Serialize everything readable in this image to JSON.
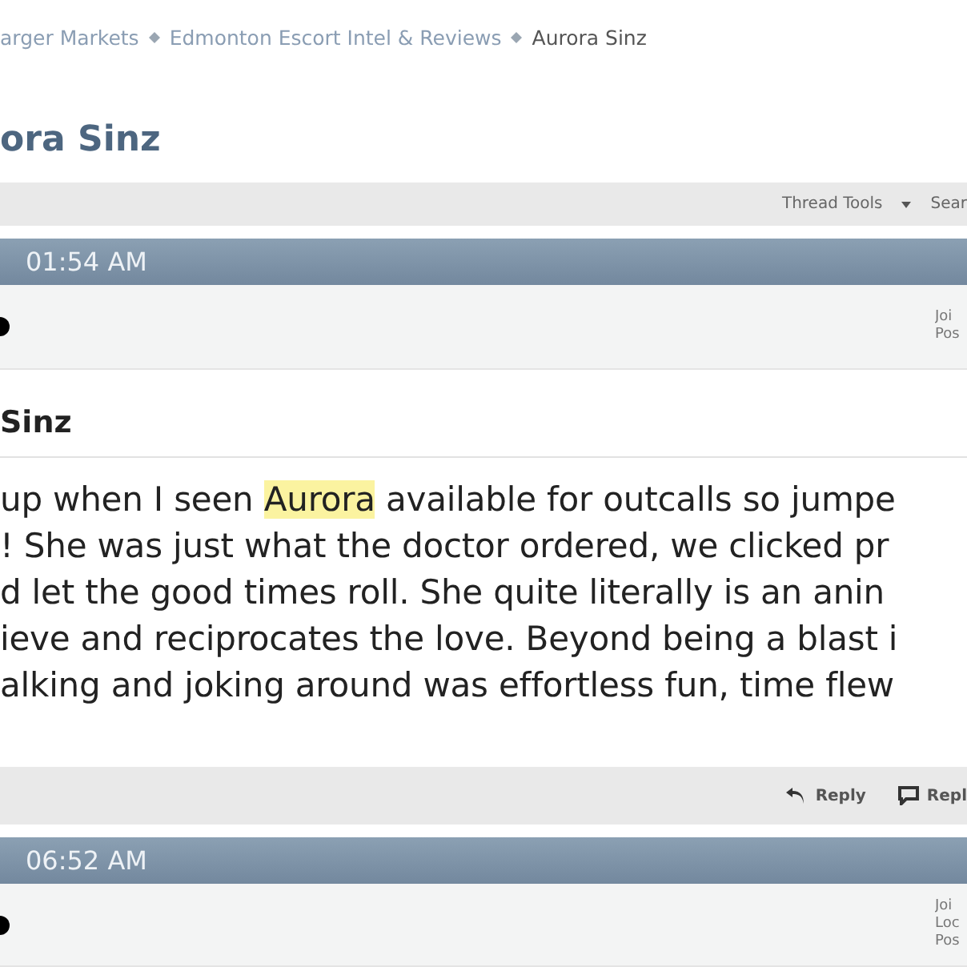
{
  "breadcrumb": [
    {
      "label": "arger Markets",
      "current": false
    },
    {
      "label": "Edmonton Escort Intel & Reviews",
      "current": false
    },
    {
      "label": "Aurora Sinz",
      "current": true
    }
  ],
  "thread_title": "ora Sinz",
  "toolbar": {
    "items": [
      "Thread Tools",
      "Sear"
    ]
  },
  "posts": [
    {
      "time": "01:54 AM",
      "user_stats": [
        "Joi",
        "Pos"
      ],
      "title": "Sinz",
      "body_lines": [
        [
          {
            "text": "up when I seen "
          },
          {
            "text": "Aurora",
            "highlight": true
          },
          {
            "text": " available for outcalls so jumpe"
          }
        ],
        [
          {
            "text": "! She was just what the doctor ordered, we clicked pr"
          }
        ],
        [
          {
            "text": "d let the good times roll. She quite literally is an anin"
          }
        ],
        [
          {
            "text": "ieve and reciprocates the love. Beyond being a blast i"
          }
        ],
        [
          {
            "text": "alking and joking around was effortless fun, time flew"
          }
        ]
      ],
      "actions": [
        {
          "kind": "reply",
          "label": "Reply"
        },
        {
          "kind": "quote",
          "label": "Repl"
        }
      ]
    },
    {
      "time": "06:52 AM",
      "user_stats": [
        "Joi",
        "Loc",
        "Pos"
      ]
    }
  ]
}
